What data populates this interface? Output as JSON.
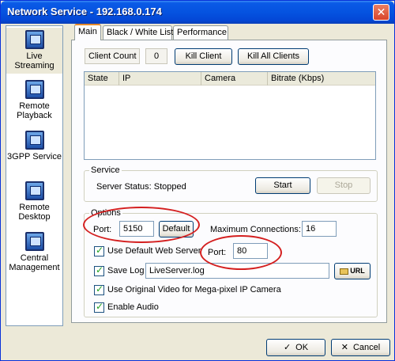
{
  "window": {
    "title": "Network Service - 192.168.0.174",
    "close_glyph": "✕"
  },
  "sidebar": {
    "items": [
      {
        "label": "Live Streaming",
        "icon": "live-streaming-icon",
        "active": true
      },
      {
        "label": "Remote Playback",
        "icon": "remote-playback-icon"
      },
      {
        "label": "3GPP Service",
        "icon": "3gpp-service-icon"
      },
      {
        "label": "Remote Desktop",
        "icon": "remote-desktop-icon"
      },
      {
        "label": "Central Management",
        "icon": "central-management-icon"
      }
    ]
  },
  "tabs": [
    {
      "label": "Main",
      "active": true
    },
    {
      "label": "Black / White List"
    },
    {
      "label": "Performance"
    }
  ],
  "clients": {
    "count_label": "Client Count",
    "count_value": "0",
    "kill_client": "Kill Client",
    "kill_all": "Kill All Clients",
    "columns": [
      "State",
      "IP",
      "Camera",
      "Bitrate (Kbps)"
    ],
    "rows": []
  },
  "service": {
    "title": "Service",
    "status": "Server Status: Stopped",
    "start": "Start",
    "stop": "Stop"
  },
  "options": {
    "title": "Options",
    "port_label": "Port:",
    "port_value": "5150",
    "default_btn": "Default",
    "max_conn_label": "Maximum Connections:",
    "max_conn_value": "16",
    "use_web_server": "Use Default Web Server",
    "web_port_label": "Port:",
    "web_port_value": "80",
    "save_log": "Save Log",
    "log_file": "LiveServer.log",
    "browse_label": "URL",
    "use_original_video": "Use Original Video for Mega-pixel IP Camera",
    "enable_audio": "Enable Audio",
    "checked": {
      "use_web_server": true,
      "save_log": true,
      "use_original_video": true,
      "enable_audio": true
    }
  },
  "footer": {
    "ok": "OK",
    "ok_glyph": "✓",
    "cancel": "Cancel",
    "cancel_glyph": "✕"
  },
  "colors": {
    "highlight_ellipse": "#d41f1f",
    "title_bar": "#0553e0"
  }
}
